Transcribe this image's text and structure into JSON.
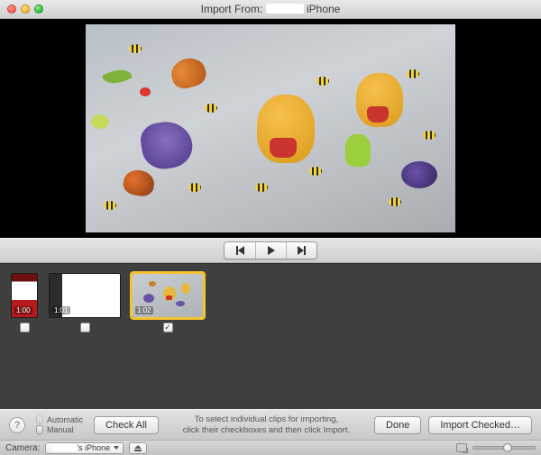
{
  "window": {
    "title_prefix": "Import From:",
    "title_suffix": "iPhone"
  },
  "clips": [
    {
      "duration": "1:00",
      "checked": false,
      "selected": false
    },
    {
      "duration": "1:01",
      "checked": false,
      "selected": false
    },
    {
      "duration": "1:02",
      "checked": true,
      "selected": true
    }
  ],
  "mode": {
    "option_auto": "Automatic",
    "option_manual": "Manual",
    "selected": "Manual"
  },
  "toolbar": {
    "help_glyph": "?",
    "check_all": "Check All",
    "hint_line1": "To select individual clips for importing,",
    "hint_line2": "click their checkboxes and then click Import.",
    "done": "Done",
    "import_checked": "Import Checked…"
  },
  "status": {
    "camera_label": "Camera:",
    "camera_value_suffix": "'s iPhone",
    "zoom_pct": 55
  }
}
